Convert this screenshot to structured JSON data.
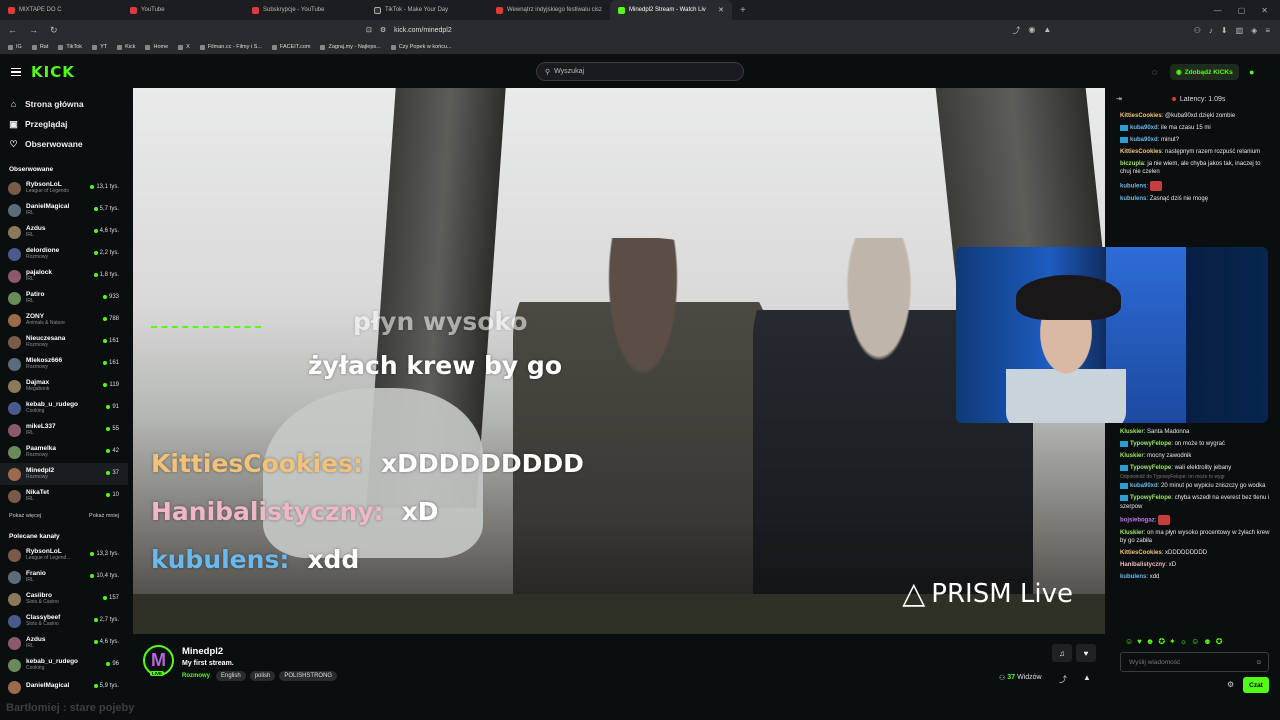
{
  "browser": {
    "tabs": [
      {
        "label": "MIXTAPE DO C",
        "icon": "youtube-icon"
      },
      {
        "label": "YouTube",
        "icon": "youtube-icon"
      },
      {
        "label": "Subskrypcje - YouTube",
        "icon": "youtube-icon"
      },
      {
        "label": "TikTok - Make Your Day",
        "icon": "tiktok-icon"
      },
      {
        "label": "Wewnątrz indyjskiego festiwalu cisz",
        "icon": "youtube-icon"
      },
      {
        "label": "Minedpl2 Stream - Watch Liv",
        "icon": "kick-icon",
        "active": true
      }
    ],
    "url": "kick.com/minedpl2",
    "bookmarks": [
      "IG",
      "Rat",
      "TikTok",
      "YT",
      "Kick",
      "Home",
      "X",
      "Filman.cc - Filmy i S...",
      "FACEIT.com",
      "Zagraj.my - Najleps...",
      "Czy Popek w końcu..."
    ]
  },
  "header": {
    "logo": "KICK",
    "search_placeholder": "Wyszukaj",
    "get_kicks": "Zdobądź KICKs"
  },
  "sidebar": {
    "nav": [
      {
        "label": "Strona główna",
        "icon": "home-icon"
      },
      {
        "label": "Przeglądaj",
        "icon": "browse-icon"
      },
      {
        "label": "Obserwowane",
        "icon": "heart-icon"
      }
    ],
    "followed_title": "Obserwowane",
    "followed": [
      {
        "name": "RybsonLoL",
        "category": "League of Legends",
        "viewers": "13,1 tys."
      },
      {
        "name": "DanielMagical",
        "category": "IRL",
        "viewers": "5,7 tys."
      },
      {
        "name": "Azdus",
        "category": "IRL",
        "viewers": "4,6 tys."
      },
      {
        "name": "delordione",
        "category": "Rozmowy",
        "viewers": "2,2 tys."
      },
      {
        "name": "pajalock",
        "category": "IRL",
        "viewers": "1,8 tys."
      },
      {
        "name": "Patiro",
        "category": "IRL",
        "viewers": "933"
      },
      {
        "name": "ZONY",
        "category": "Animals & Nature",
        "viewers": "788"
      },
      {
        "name": "Nieuczesana",
        "category": "Rozmowy",
        "viewers": "161"
      },
      {
        "name": "Mlekosz666",
        "category": "Rozmowy",
        "viewers": "161"
      },
      {
        "name": "Dajmax",
        "category": "Megabonk",
        "viewers": "119"
      },
      {
        "name": "kebab_u_rudego",
        "category": "Cooking",
        "viewers": "91"
      },
      {
        "name": "mikeL337",
        "category": "IRL",
        "viewers": "55"
      },
      {
        "name": "Paamelka",
        "category": "Rozmowy",
        "viewers": "42"
      },
      {
        "name": "Minedpl2",
        "category": "Rozmowy",
        "viewers": "37"
      },
      {
        "name": "NikaTet",
        "category": "IRL",
        "viewers": "10"
      }
    ],
    "show_more": "Pokaż więcej",
    "show_less": "Pokaż mniej",
    "recommended_title": "Polecane kanały",
    "recommended": [
      {
        "name": "RybsonLoL",
        "category": "League of Legend...",
        "viewers": "13,3 tys."
      },
      {
        "name": "Franio",
        "category": "IRL",
        "viewers": "10,4 tys."
      },
      {
        "name": "Casiibro",
        "category": "Slots & Casino",
        "viewers": "157"
      },
      {
        "name": "Classybeef",
        "category": "Slots & Casino",
        "viewers": "2,7 tys."
      },
      {
        "name": "Azdus",
        "category": "IRL",
        "viewers": "4,6 tys."
      },
      {
        "name": "kebab_u_rudego",
        "category": "Cooking",
        "viewers": "96"
      },
      {
        "name": "DanielMagical",
        "category": "",
        "viewers": "5,9 tys."
      }
    ]
  },
  "video": {
    "overlay_partial_1": "płyn wysoko",
    "overlay_partial_2": "żyłach krew by go",
    "overlay_lines": [
      {
        "user": "KittiesCookies:",
        "text": "xDDDDDDDDD",
        "color": "#f2c27a"
      },
      {
        "user": "Hanibalistyczny:",
        "text": "xD",
        "color": "#f0b8c4"
      },
      {
        "user": "kubulens:",
        "text": "xdd",
        "color": "#6ab8f0"
      }
    ],
    "watermark": "PRISM Live"
  },
  "chat": {
    "latency": "Latency: 1.09s",
    "messages_top": [
      {
        "user": "KittiesCookies",
        "text": "@kuba90xd dzięki zombie",
        "color": "#f2c27a"
      },
      {
        "user": "kuba90xd",
        "text": "ile ma czasu 15 mi",
        "color": "#6ab8f0",
        "badge": true
      },
      {
        "user": "kuba90xd",
        "text": "minut?",
        "color": "#6ab8f0",
        "badge": true
      },
      {
        "user": "KittiesCookies",
        "text": "następnym razem rozpuść relanium",
        "color": "#f2c27a"
      },
      {
        "user": "biczupla",
        "text": "ja nie wiem, ale chyba jakos tak, inaczej to chuj nie czelen",
        "color": "#9ee86a"
      },
      {
        "user": "kubulens",
        "text": "",
        "color": "#6ab8f0"
      },
      {
        "user": "kubulens",
        "text": "Zasnąć dziś nie mogę",
        "color": "#6ab8f0"
      }
    ],
    "messages_bottom": [
      {
        "user": "Kluskier",
        "text": "Santa Madonna",
        "color": "#9ee86a"
      },
      {
        "user": "TypowyFelope",
        "text": "on może to wygrać",
        "color": "#9ee86a",
        "badge": true
      },
      {
        "user": "Kluskier",
        "text": "mocny zawodnik",
        "color": "#9ee86a"
      },
      {
        "user": "TypowyFelope",
        "text": "wali elektrolity jebany",
        "color": "#9ee86a",
        "badge": true
      },
      {
        "user": "kuba90xd",
        "text": "20 minut po wypiciu zniszczy go wodka",
        "color": "#6ab8f0",
        "badge": true
      },
      {
        "user": "TypowyFelope",
        "text": "chyba wszedł na everest bez tlenu i szerpow",
        "color": "#9ee86a",
        "badge": true
      },
      {
        "user": "bojsiebogaz",
        "text": "",
        "color": "#c07ae8"
      },
      {
        "user": "Kluskier",
        "text": "on ma płyn wysoko procentowy w żyłach krew by go zabiła",
        "color": "#9ee86a"
      },
      {
        "user": "KittiesCookies",
        "text": "xDDDDDDDDD",
        "color": "#f2c27a"
      },
      {
        "user": "Hanibalistyczny",
        "text": "xD",
        "color": "#f0b8c4"
      },
      {
        "user": "kubulens",
        "text": "xdd",
        "color": "#6ab8f0"
      }
    ],
    "reply_hint": "Odpowiedź do TypowyFelope: on może to wygr",
    "input_placeholder": "Wyślij wiadomość",
    "send_label": "Czat"
  },
  "stream": {
    "avatar_letter": "M",
    "live_label": "LIVE",
    "name": "Minedpl2",
    "title": "My first stream.",
    "category": "Rozmowy",
    "tags": [
      "English",
      "polish",
      "POLISHSTRONG"
    ],
    "viewers_count": "37",
    "viewers_label": "Widzów",
    "ghost_text": "Bartłomiej : stare pojeby"
  }
}
